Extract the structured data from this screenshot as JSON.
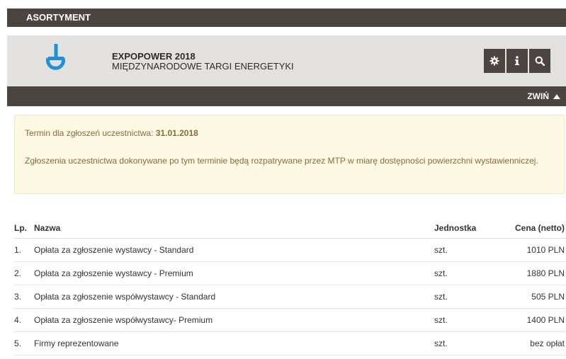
{
  "section_title": "ASORTYMENT",
  "event": {
    "title": "EXPOPOWER 2018",
    "subtitle": "MIĘDZYNARODOWE TARGI ENERGETYKI"
  },
  "toolbar": {
    "settings_icon": "gear-icon",
    "info_icon": "info-icon",
    "search_icon": "search-icon"
  },
  "collapse_label": "ZWIŃ",
  "notice": {
    "deadline_label": "Termin dla zgłoszeń uczestnictwa:",
    "deadline_date": "31.01.2018",
    "note": "Zgłoszenia uczestnictwa dokonywane po tym terminie będą rozpatrywane przez MTP w miarę dostępności powierzchni wystawienniczej."
  },
  "table": {
    "headers": {
      "lp": "Lp.",
      "name": "Nazwa",
      "unit": "Jednostka",
      "price": "Cena (netto)"
    },
    "rows": [
      {
        "lp": "1.",
        "name": "Opłata za zgłoszenie wystawcy - Standard",
        "unit": "szt.",
        "price": "1010 PLN"
      },
      {
        "lp": "2.",
        "name": "Opłata za zgłoszenie wystawcy - Premium",
        "unit": "szt.",
        "price": "1880 PLN"
      },
      {
        "lp": "3.",
        "name": "Opłata za zgłoszenie współwystawcy - Standard",
        "unit": "szt.",
        "price": "505 PLN"
      },
      {
        "lp": "4.",
        "name": "Opłata za zgłoszenie współwystawcy- Premium",
        "unit": "szt.",
        "price": "1400 PLN"
      },
      {
        "lp": "5.",
        "name": "Firmy reprezentowane",
        "unit": "szt.",
        "price": "bez opłat"
      }
    ]
  },
  "colors": {
    "dark_bar": "#4b4441",
    "header_bg": "#e2e1df",
    "logo_blue": "#1f8fd6",
    "notice_bg": "#fcf8e3",
    "notice_text": "#8a6d3b"
  }
}
